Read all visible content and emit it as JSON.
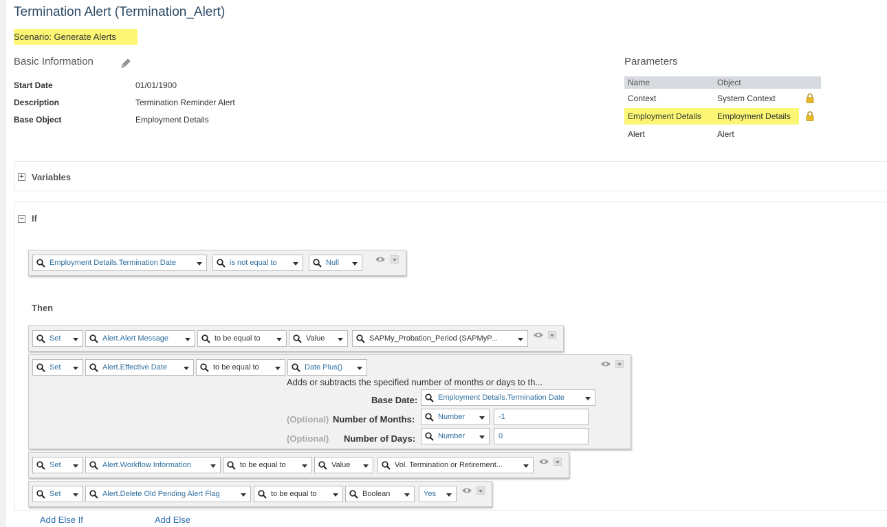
{
  "title": "Termination Alert (Termination_Alert)",
  "scenario": "Scenario: Generate Alerts",
  "basic_info": {
    "heading": "Basic Information",
    "fields": [
      {
        "label": "Start Date",
        "value": "01/01/1900"
      },
      {
        "label": "Description",
        "value": "Termination Reminder Alert"
      },
      {
        "label": "Base Object",
        "value": "Employment Details"
      }
    ]
  },
  "parameters": {
    "heading": "Parameters",
    "columns": [
      "Name",
      "Object"
    ],
    "rows": [
      {
        "name": "Context",
        "object": "System Context",
        "locked": true,
        "highlighted": false
      },
      {
        "name": "Employment Details",
        "object": "Employment Details",
        "locked": true,
        "highlighted": true
      },
      {
        "name": "Alert",
        "object": "Alert",
        "locked": false,
        "highlighted": false
      }
    ]
  },
  "variables": {
    "label": "Variables",
    "toggle": "+"
  },
  "if_section": {
    "label": "If",
    "toggle": "−",
    "condition": {
      "field": "Employment Details.Termination Date",
      "operator": "is not equal to",
      "value": "Null"
    }
  },
  "then_section": {
    "label": "Then",
    "rows": [
      {
        "action": "Set",
        "target": "Alert.Alert Message",
        "operator": "to be equal to",
        "type": "Value",
        "value": "SAPMy_Probation_Period (SAPMyP..."
      },
      {
        "action": "Set",
        "target": "Alert.Effective Date",
        "operator": "to be equal to",
        "type": "Date Plus()",
        "description": "Adds or subtracts the specified number of months or days to th...",
        "params": {
          "base_date_label": "Base Date:",
          "base_date_value": "Employment Details.Termination Date",
          "optional_label": "(Optional)",
          "months_label": "Number of Months:",
          "months_type": "Number",
          "months_value": "-1",
          "days_label": "Number of Days:",
          "days_type": "Number",
          "days_value": "0"
        }
      },
      {
        "action": "Set",
        "target": "Alert.Workflow Information",
        "operator": "to be equal to",
        "type": "Value",
        "value": "Vol. Termination or Retirement..."
      },
      {
        "action": "Set",
        "target": "Alert.Delete Old Pending Alert Flag",
        "operator": "to be equal to",
        "type": "Boolean",
        "value": "Yes"
      }
    ]
  },
  "links": {
    "add_else_if": "Add Else If",
    "add_else": "Add Else"
  },
  "colors": {
    "highlight": "#fbf774",
    "link": "#2f6fb0",
    "title": "#2b4a66"
  }
}
